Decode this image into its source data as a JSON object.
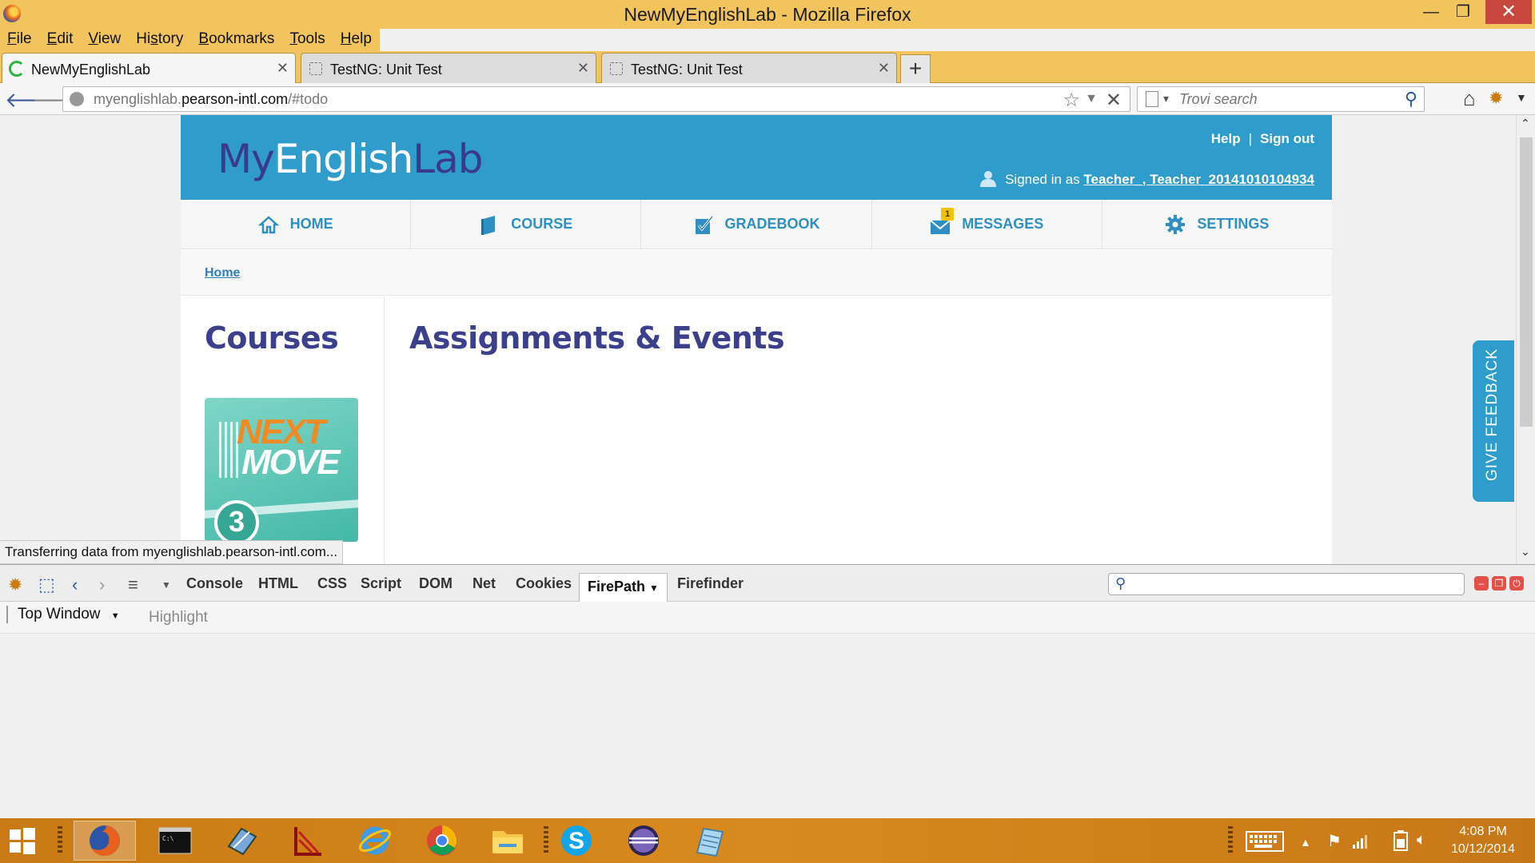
{
  "window": {
    "title": "NewMyEnglishLab - Mozilla Firefox",
    "minimize": "—",
    "maximize": "❐",
    "close": "✕"
  },
  "menu": [
    {
      "pre": "",
      "key": "F",
      "post": "ile"
    },
    {
      "pre": "",
      "key": "E",
      "post": "dit"
    },
    {
      "pre": "",
      "key": "V",
      "post": "iew"
    },
    {
      "pre": "Hi",
      "key": "s",
      "post": "tory"
    },
    {
      "pre": "",
      "key": "B",
      "post": "ookmarks"
    },
    {
      "pre": "",
      "key": "T",
      "post": "ools"
    },
    {
      "pre": "",
      "key": "H",
      "post": "elp"
    }
  ],
  "tabs": [
    {
      "label": "NewMyEnglishLab",
      "active": true
    },
    {
      "label": "TestNG: Unit Test",
      "active": false
    },
    {
      "label": "TestNG: Unit Test",
      "active": false
    }
  ],
  "new_tab": "+",
  "address": {
    "prefix": "myenglishlab.",
    "domain": "pearson-intl.com",
    "path": "/#todo"
  },
  "search": {
    "placeholder": "Trovi search"
  },
  "site": {
    "logo": {
      "my": "My",
      "english": "English",
      "lab": "Lab"
    },
    "help": "Help",
    "sep": "|",
    "sign_out": "Sign out",
    "signed_in_prefix": "Signed in as",
    "user": "Teacher_, Teacher_20141010104934",
    "nav": [
      {
        "label": "HOME",
        "icon": "home-icon"
      },
      {
        "label": "COURSE",
        "icon": "book-icon"
      },
      {
        "label": "GRADEBOOK",
        "icon": "gradebook-check-icon"
      },
      {
        "label": "MESSAGES",
        "icon": "envelope-icon",
        "badge": "1"
      },
      {
        "label": "SETTINGS",
        "icon": "gear-icon"
      }
    ],
    "breadcrumb": "Home",
    "courses_title": "Courses",
    "course_card": {
      "line1": "NEXT",
      "line2": "MOVE",
      "level": "3"
    },
    "assignments_title": "Assignments & Events",
    "feedback": "GIVE FEEDBACK"
  },
  "status": "Transferring data from myenglishlab.pearson-intl.com...",
  "firebug": {
    "tabs": [
      "Console",
      "HTML",
      "CSS",
      "Script",
      "DOM",
      "Net",
      "Cookies",
      "FirePath",
      "Firefinder"
    ],
    "selected_tab": "FirePath",
    "context": "Top Window",
    "highlight": "Highlight"
  },
  "clock": {
    "time": "4:08 PM",
    "date": "10/12/2014"
  },
  "colors": {
    "header_blue": "#2f9ccc",
    "title_navy": "#3c3f8c",
    "nav_text": "#2f8fc2",
    "chrome_orange": "#f2c45d"
  }
}
